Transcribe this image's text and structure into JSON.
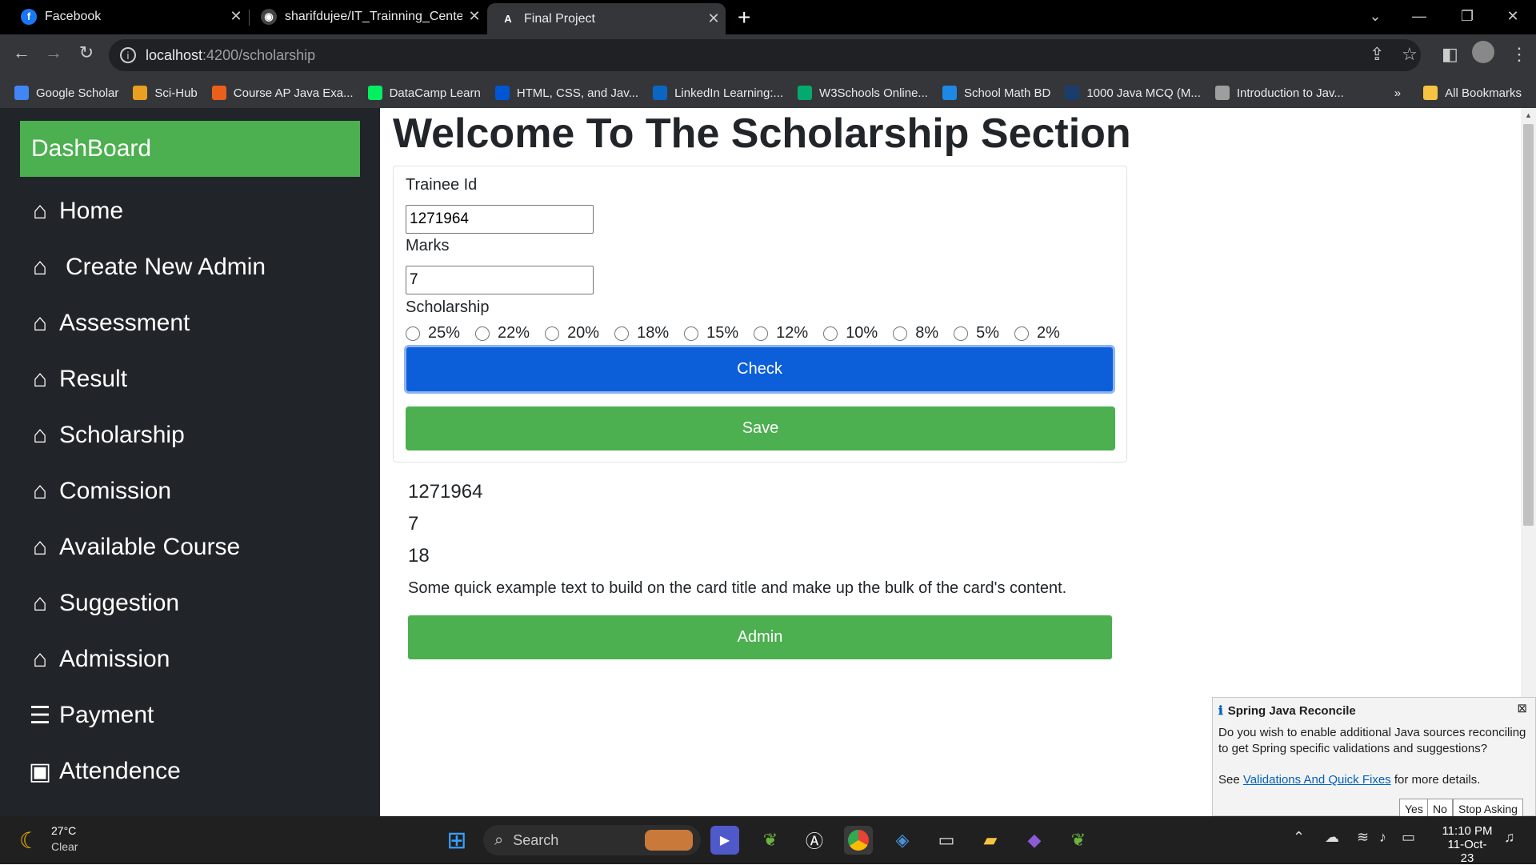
{
  "browser": {
    "tabs": [
      {
        "title": "Facebook",
        "icon": "facebook-icon",
        "color": "#1877f2"
      },
      {
        "title": "sharifdujee/IT_Trainning_Center",
        "icon": "github-icon",
        "color": "#333333"
      },
      {
        "title": "Final Project",
        "icon": "angular-icon",
        "color": "#ffffff"
      }
    ],
    "url_host": "localhost",
    "url_path": ":4200/scholarship",
    "bookmarks": [
      {
        "label": "Google Scholar",
        "color": "#4285f4"
      },
      {
        "label": "Sci-Hub",
        "color": "#e8a020"
      },
      {
        "label": "Course AP Java Exa...",
        "color": "#e8601c"
      },
      {
        "label": "DataCamp Learn",
        "color": "#03ef62"
      },
      {
        "label": "HTML, CSS, and Jav...",
        "color": "#0056d2"
      },
      {
        "label": "LinkedIn Learning:...",
        "color": "#0a66c2"
      },
      {
        "label": "W3Schools Online...",
        "color": "#04aa6d"
      },
      {
        "label": "School Math BD",
        "color": "#1e88e5"
      },
      {
        "label": "1000 Java MCQ (M...",
        "color": "#1a3d6d"
      },
      {
        "label": "Introduction to Jav...",
        "color": "#9e9e9e"
      }
    ],
    "more_bookmarks": "»",
    "all_bookmarks": "All Bookmarks"
  },
  "sidebar": {
    "dashboard": "DashBoard",
    "items": [
      {
        "label": "Home",
        "icon": "home-icon"
      },
      {
        "label": "Create New Admin",
        "icon": "home-icon"
      },
      {
        "label": "Assessment",
        "icon": "home-icon"
      },
      {
        "label": "Result",
        "icon": "home-icon"
      },
      {
        "label": "Scholarship",
        "icon": "home-icon"
      },
      {
        "label": "Comission",
        "icon": "home-icon"
      },
      {
        "label": "Available Course",
        "icon": "home-icon"
      },
      {
        "label": "Suggestion",
        "icon": "home-icon"
      },
      {
        "label": "Admission",
        "icon": "home-icon"
      },
      {
        "label": "Payment",
        "icon": "list-icon"
      },
      {
        "label": "Attendence",
        "icon": "contact-card-icon"
      }
    ]
  },
  "main": {
    "title": "Welcome To The Scholarship Section",
    "form": {
      "trainee_id_label": "Trainee Id",
      "trainee_id_value": "1271964",
      "marks_label": "Marks",
      "marks_value": "7",
      "scholarship_label": "Scholarship",
      "options": [
        "25%",
        "22%",
        "20%",
        "18%",
        "15%",
        "12%",
        "10%",
        "8%",
        "5%",
        "2%"
      ],
      "check_button": "Check",
      "save_button": "Save"
    },
    "result": {
      "trainee_id": "1271964",
      "marks": "7",
      "scholarship": "18",
      "description": "Some quick example text to build on the card title and make up the bulk of the card's content.",
      "admin_button": "Admin"
    }
  },
  "notification": {
    "title": "Spring Java Reconcile",
    "body": "Do you wish to enable additional Java sources reconciling to get Spring specific validations and suggestions?",
    "see": "See",
    "link": "Validations And Quick Fixes",
    "link_suffix": "for more details.",
    "buttons": [
      "Yes",
      "No",
      "Stop Asking"
    ]
  },
  "taskbar": {
    "temperature": "27°C",
    "weather": "Clear",
    "search_placeholder": "Search",
    "time": "11:10 PM",
    "date": "11-Oct-23"
  },
  "colors": {
    "sidebar_bg": "#212529",
    "green": "#4caf50",
    "blue": "#0d5fd9"
  }
}
